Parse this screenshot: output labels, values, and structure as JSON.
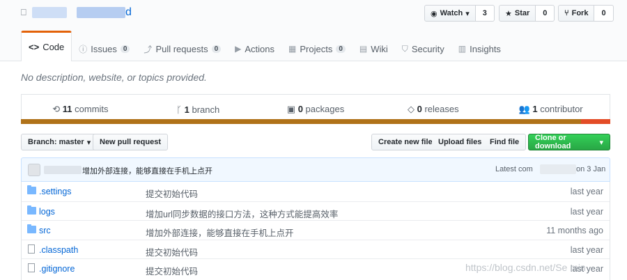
{
  "repo": {
    "name_suffix": "d"
  },
  "actions": {
    "watch_label": "Watch",
    "watch_count": "3",
    "star_label": "Star",
    "star_count": "0",
    "fork_label": "Fork",
    "fork_count": "0"
  },
  "tabs": [
    {
      "label": "Code",
      "icon": "code-icon"
    },
    {
      "label": "Issues",
      "count": "0",
      "icon": "issue-icon"
    },
    {
      "label": "Pull requests",
      "count": "0",
      "icon": "pull-request-icon"
    },
    {
      "label": "Actions",
      "icon": "play-icon"
    },
    {
      "label": "Projects",
      "count": "0",
      "icon": "project-icon"
    },
    {
      "label": "Wiki",
      "icon": "book-icon"
    },
    {
      "label": "Security",
      "icon": "shield-icon"
    },
    {
      "label": "Insights",
      "icon": "graph-icon"
    }
  ],
  "description": "No description, website, or topics provided.",
  "summary": {
    "commits_count": "11",
    "commits_label": "commits",
    "branch_count": "1",
    "branch_label": "branch",
    "packages_count": "0",
    "packages_label": "packages",
    "releases_count": "0",
    "releases_label": "releases",
    "contributors_count": "1",
    "contributors_label": "contributor"
  },
  "language_bar": {
    "primary_color": "#b07219",
    "secondary_color": "#e34c26"
  },
  "toolbar": {
    "branch_label": "Branch: master",
    "new_pr": "New pull request",
    "create_file": "Create new file",
    "upload_files": "Upload files",
    "find_file": "Find file",
    "clone": "Clone or download"
  },
  "latest_commit": {
    "message": "增加外部连接，能够直接在手机上点开",
    "latest_label": "Latest com",
    "date_suffix": "on 3 Jan"
  },
  "files": [
    {
      "type": "folder",
      "name": ".settings",
      "message": "提交初始代码",
      "age": "last year"
    },
    {
      "type": "folder",
      "name": "logs",
      "message": "增加url同步数据的接口方法，这种方式能提高效率",
      "age": "last year"
    },
    {
      "type": "folder",
      "name": "src",
      "message": "增加外部连接，能够直接在手机上点开",
      "age": "11 months ago"
    },
    {
      "type": "file",
      "name": ".classpath",
      "message": "提交初始代码",
      "age": "last year"
    },
    {
      "type": "file",
      "name": ".gitignore",
      "message": "提交初始代码",
      "age": "last year"
    }
  ],
  "watermark": "https://blog.csdn.net/Se  min"
}
